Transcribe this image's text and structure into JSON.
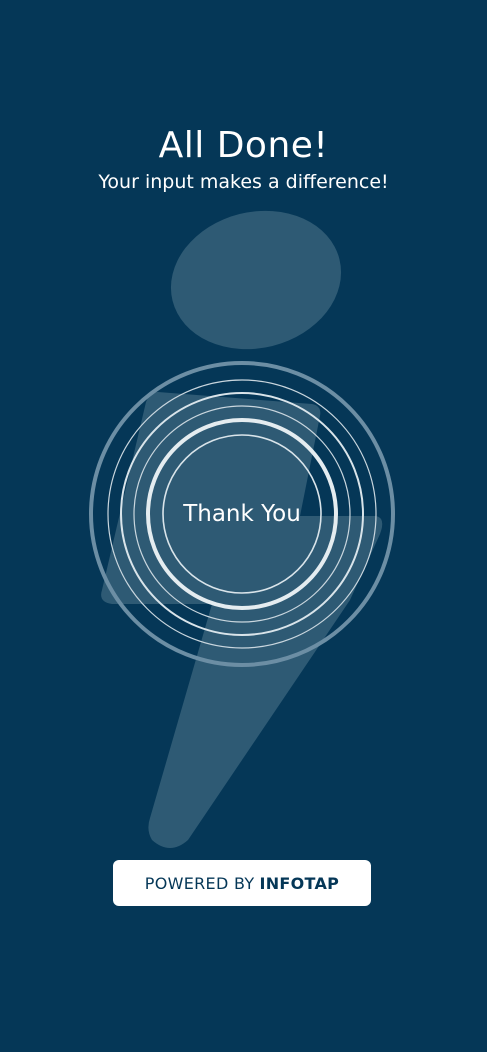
{
  "header": {
    "title": "All Done!",
    "subtitle": "Your input makes a difference!"
  },
  "center": {
    "label": "Thank You"
  },
  "footer": {
    "powered_prefix": "POWERED BY",
    "powered_brand": "INFOTAP"
  },
  "icons": {
    "background_logo": "info-logo-icon",
    "rings": "concentric-rings-icon"
  },
  "colors": {
    "background": "#053757",
    "logo_overlay": "#2e5a74",
    "text": "#ffffff",
    "ring": "#d9e4ea"
  }
}
